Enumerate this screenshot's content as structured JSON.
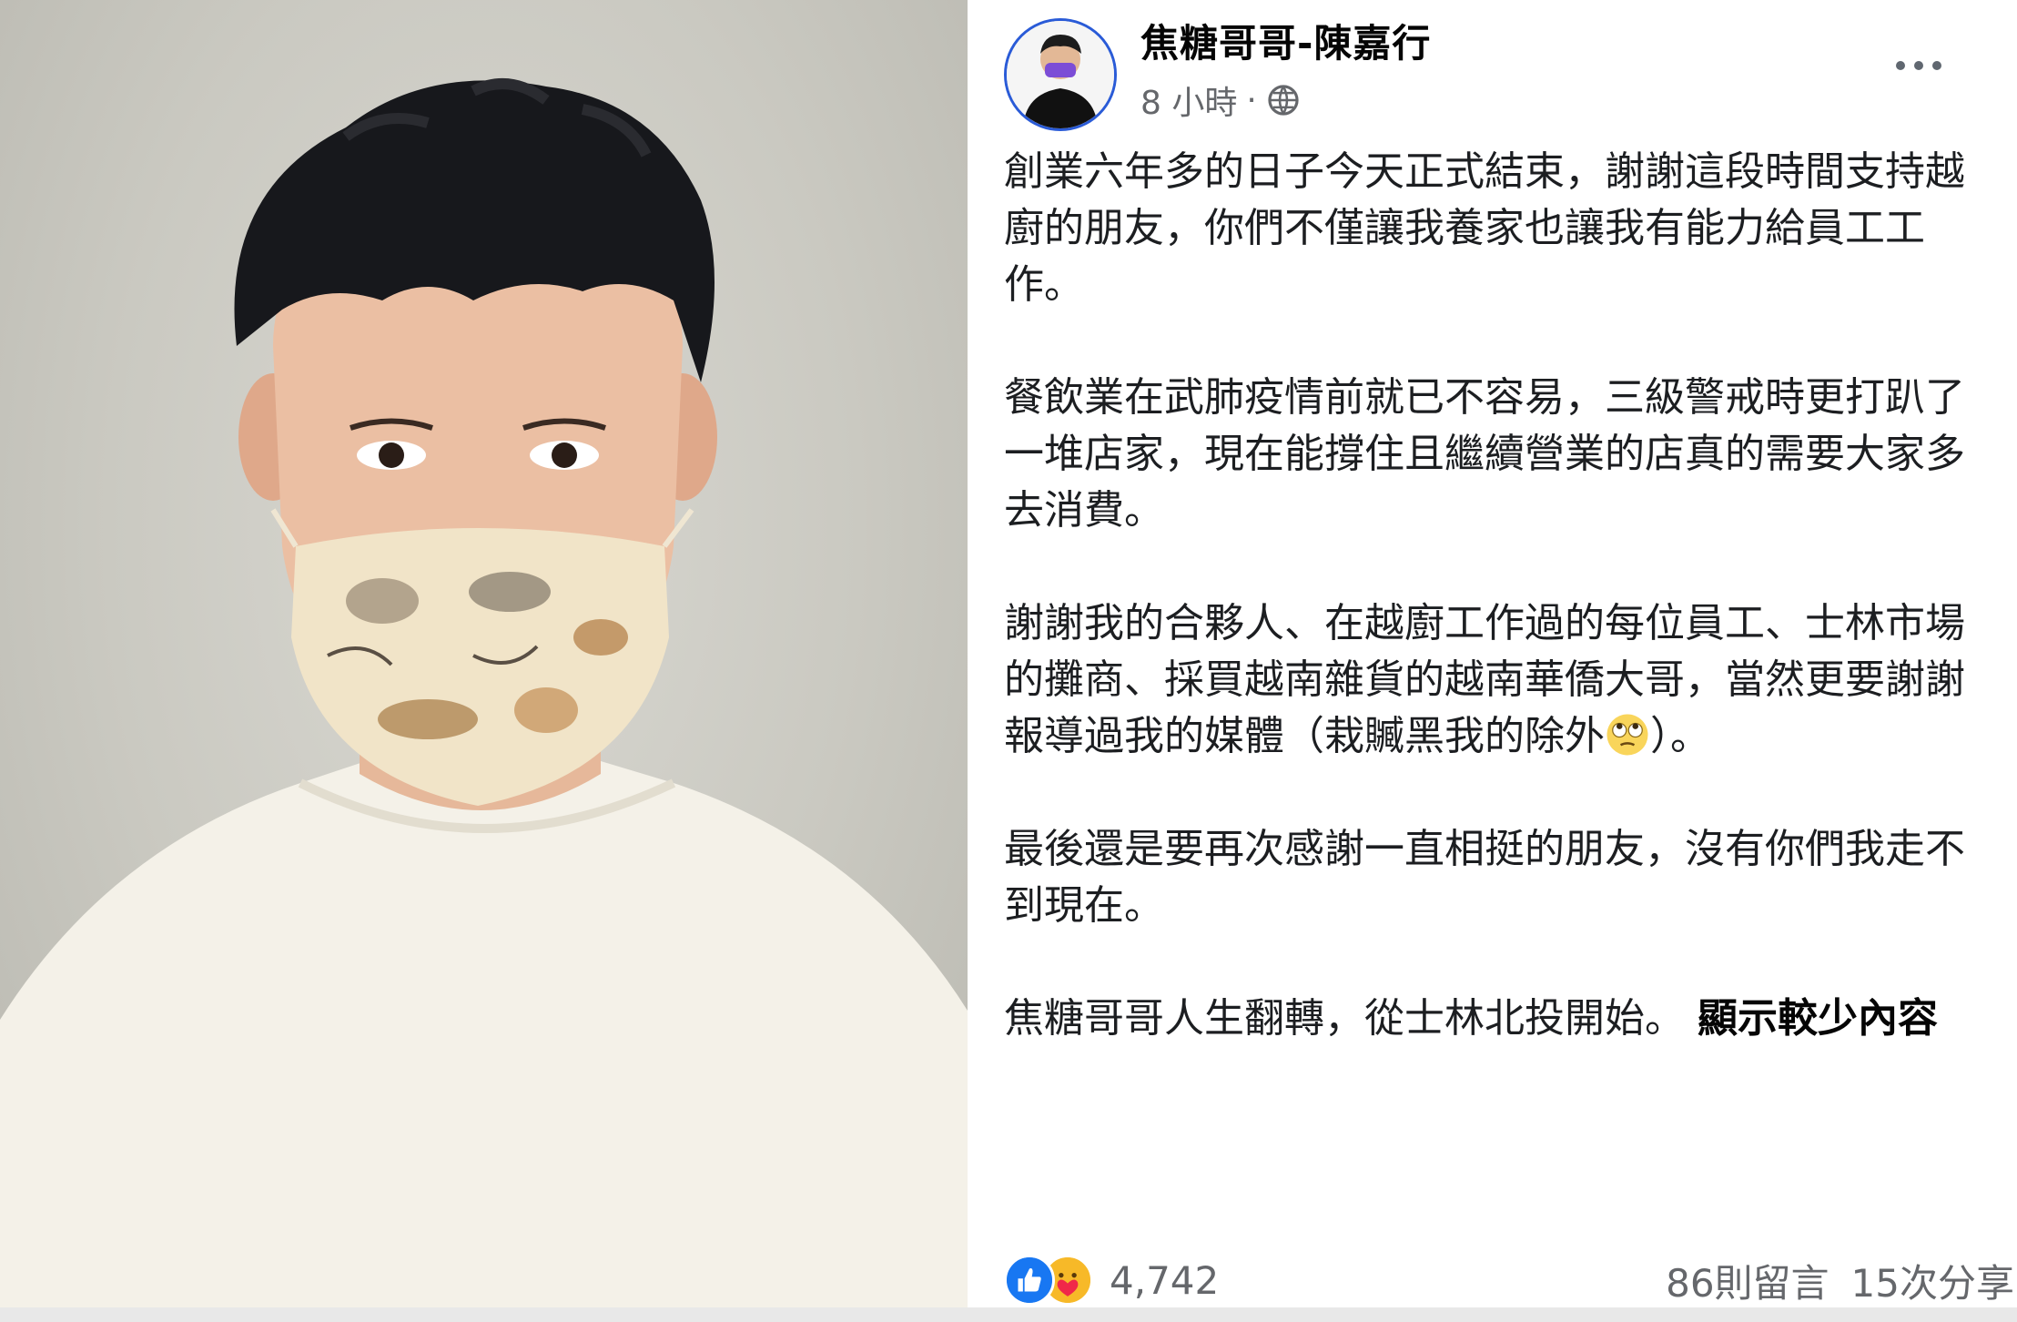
{
  "post": {
    "author": "焦糖哥哥-陳嘉行",
    "time": "8 小時",
    "time_sep": "·",
    "paragraphs": [
      "創業六年多的日子今天正式結束，謝謝這段時間支持越廚的朋友，你們不僅讓我養家也讓我有能力給員工工作。",
      "餐飲業在武肺疫情前就已不容易，三級警戒時更打趴了一堆店家，現在能撐住且繼續營業的店真的需要大家多去消費。",
      "謝謝我的合夥人、在越廚工作過的每位員工、士林市場的攤商、採買越南雜貨的越南華僑大哥，當然更要謝謝報導過我的媒體（栽贓黑我的除外",
      "最後還是要再次感謝一直相挺的朋友，沒有你們我走不到現在。",
      "焦糖哥哥人生翻轉，從士林北投開始。"
    ],
    "paragraph3_tail": "）。",
    "show_less": "顯示較少內容",
    "emoji_icon": "rolling-eyes-emoji"
  },
  "footer": {
    "reaction_count": "4,742",
    "comments": "86則留言",
    "shares": "15次分享",
    "reactions": [
      "like-icon",
      "care-icon"
    ]
  },
  "colors": {
    "link_blue": "#1877f2",
    "secondary_text": "#65676b",
    "avatar_ring": "#2a5bd7"
  }
}
